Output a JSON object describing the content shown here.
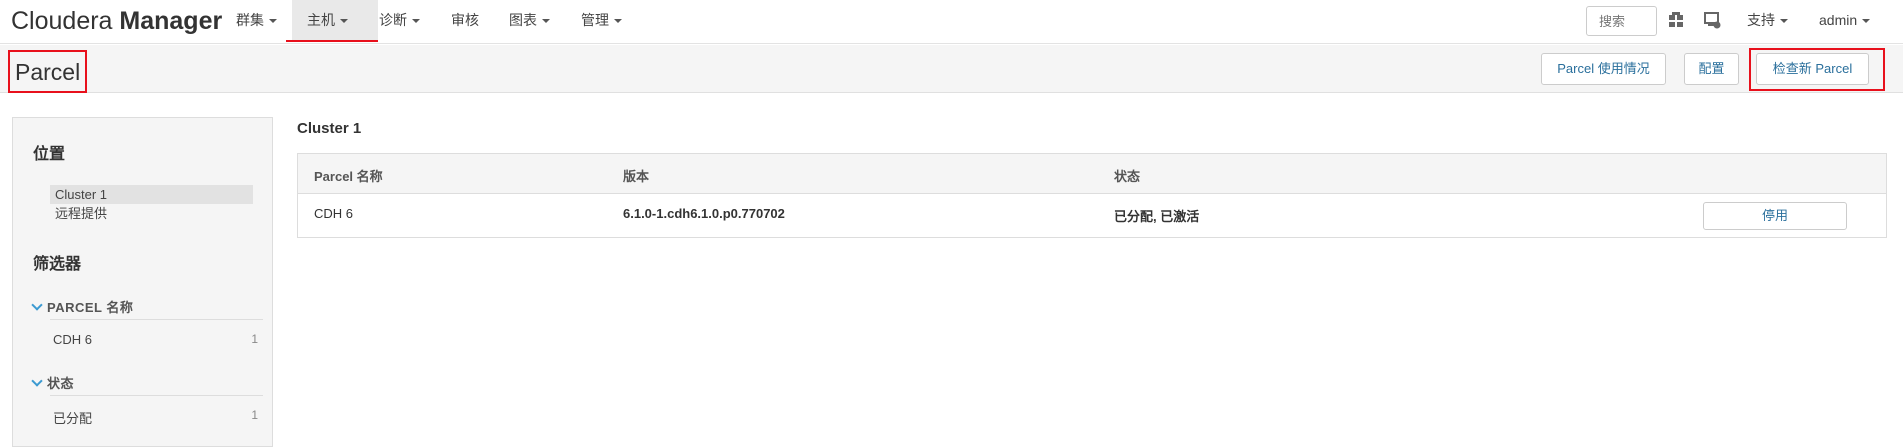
{
  "app": {
    "brand_light": "Cloudera",
    "brand_bold": "Manager"
  },
  "nav": {
    "items": [
      {
        "label": "群集",
        "has_caret": true
      },
      {
        "label": "主机",
        "has_caret": true,
        "active": true
      },
      {
        "label": "诊断",
        "has_caret": true
      },
      {
        "label": "审核",
        "has_caret": false
      },
      {
        "label": "图表",
        "has_caret": true
      },
      {
        "label": "管理",
        "has_caret": true
      }
    ],
    "search_placeholder": "搜索",
    "support_label": "支持",
    "user_label": "admin"
  },
  "header": {
    "title": "Parcel",
    "buttons": [
      "Parcel 使用情况",
      "配置",
      "检查新 Parcel"
    ]
  },
  "sidebar": {
    "location_heading": "位置",
    "locations": [
      {
        "label": "Cluster 1",
        "selected": true
      },
      {
        "label": "远程提供",
        "selected": false
      }
    ],
    "filter_heading": "筛选器",
    "filters": [
      {
        "title": "PARCEL 名称",
        "items": [
          {
            "label": "CDH 6",
            "count": "1"
          }
        ]
      },
      {
        "title": "状态",
        "items": [
          {
            "label": "已分配",
            "count": "1"
          }
        ]
      }
    ]
  },
  "main": {
    "cluster_title": "Cluster 1",
    "columns": [
      "Parcel 名称",
      "版本",
      "状态"
    ],
    "rows": [
      {
        "name": "CDH 6",
        "version": "6.1.0-1.cdh6.1.0.p0.770702",
        "status": "已分配, 已激活",
        "action": "停用"
      }
    ]
  },
  "colors": {
    "accent_red": "#e8101c",
    "link_blue": "#2a6f9c",
    "chevron_blue": "#3c9ad1"
  }
}
